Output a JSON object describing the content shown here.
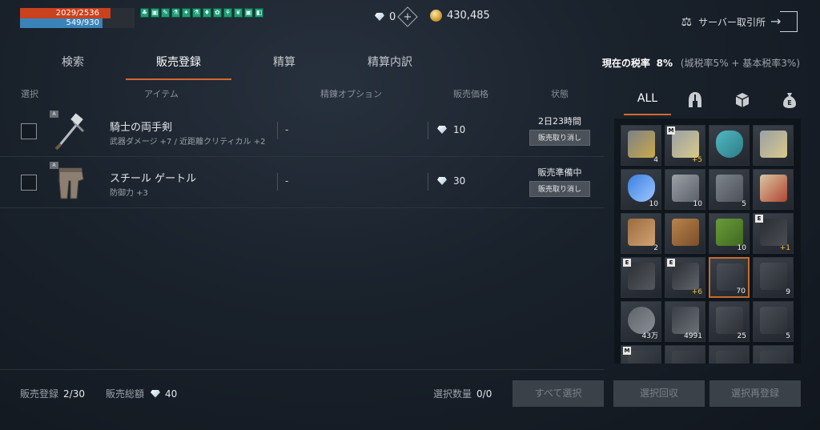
{
  "status": {
    "hp": "2029/2536",
    "mp": "549/930",
    "hp_fraction": 0.8,
    "mp_fraction": 0.59
  },
  "buffs": [
    "buff-icon-1",
    "buff-icon-2",
    "buff-icon-3",
    "buff-icon-4",
    "buff-icon-5",
    "buff-icon-6",
    "buff-icon-7",
    "buff-icon-8",
    "buff-icon-9",
    "buff-icon-10",
    "buff-icon-11",
    "buff-icon-12"
  ],
  "currency": {
    "diamonds": "0",
    "gold": "430,485"
  },
  "exchange": {
    "label": "サーバー取引所"
  },
  "tabs": [
    {
      "label": "検索"
    },
    {
      "label": "販売登録"
    },
    {
      "label": "精算"
    },
    {
      "label": "精算内訳"
    }
  ],
  "tax": {
    "label": "現在の税率",
    "value": "8%",
    "detail": "(城税率5% + 基本税率3%)"
  },
  "columns": {
    "select": "選択",
    "item": "アイテム",
    "refine": "精錬オプション",
    "price": "販売価格",
    "state": "状態"
  },
  "listings": [
    {
      "name": "騎士の両手剣",
      "stats": "武器ダメージ +7 / 近距離クリティカル +2",
      "refine": "-",
      "price": "10",
      "status": "2日23時間",
      "cancel": "販売取り消し",
      "tier": "A"
    },
    {
      "name": "スチール ゲートル",
      "stats": "防御力 +3",
      "refine": "-",
      "price": "30",
      "status": "販売準備中",
      "cancel": "販売取り消し",
      "tier": "A"
    }
  ],
  "footer": {
    "registered_label": "販売登録",
    "registered_value": "2/30",
    "total_label": "販売総額",
    "total_value": "40",
    "selected_label": "選択数量",
    "selected_value": "0/0",
    "select_all": "すべて選択",
    "collect": "選択回収",
    "reregister": "選択再登録"
  },
  "inventory": {
    "tabs": [
      {
        "label": "ALL",
        "icon": ""
      },
      {
        "label": "",
        "icon": "helmet-icon"
      },
      {
        "label": "",
        "icon": "box-icon"
      },
      {
        "label": "",
        "icon": "money-bag-icon"
      }
    ],
    "slots": [
      {
        "icon": "shield-stone-icon",
        "qty": "4",
        "tag": ""
      },
      {
        "icon": "sword-icon",
        "qty": "+5",
        "tag": "M"
      },
      {
        "icon": "crystal-icon",
        "qty": "",
        "tag": ""
      },
      {
        "icon": "sword-icon",
        "qty": "",
        "tag": ""
      },
      {
        "icon": "blue-crystal-icon",
        "qty": "10",
        "tag": ""
      },
      {
        "icon": "iron-ingot-icon",
        "qty": "10",
        "tag": ""
      },
      {
        "icon": "metal-sheet-icon",
        "qty": "5",
        "tag": ""
      },
      {
        "icon": "scroll-icon",
        "qty": "",
        "tag": ""
      },
      {
        "icon": "log-icon",
        "qty": "2",
        "tag": ""
      },
      {
        "icon": "leather-icon",
        "qty": "",
        "tag": ""
      },
      {
        "icon": "green-log-icon",
        "qty": "10",
        "tag": ""
      },
      {
        "icon": "cloak-icon",
        "qty": "+1",
        "tag": "E"
      },
      {
        "icon": "belt-icon",
        "qty": "",
        "tag": "E"
      },
      {
        "icon": "bow-icon",
        "qty": "+6",
        "tag": "E"
      },
      {
        "icon": "rune-scroll-icon",
        "qty": "70",
        "tag": ""
      },
      {
        "icon": "rune-scroll-icon",
        "qty": "9",
        "tag": ""
      },
      {
        "icon": "disc-icon",
        "qty": "43万",
        "tag": ""
      },
      {
        "icon": "ore-icon",
        "qty": "4991",
        "tag": ""
      },
      {
        "icon": "gauntlet-icon",
        "qty": "25",
        "tag": ""
      },
      {
        "icon": "rune-scroll-icon",
        "qty": "5",
        "tag": ""
      },
      {
        "icon": "item-icon",
        "qty": "",
        "tag": "M"
      },
      {
        "icon": "item-icon",
        "qty": "",
        "tag": ""
      },
      {
        "icon": "item-icon",
        "qty": "",
        "tag": ""
      },
      {
        "icon": "item-icon",
        "qty": "",
        "tag": ""
      }
    ]
  }
}
